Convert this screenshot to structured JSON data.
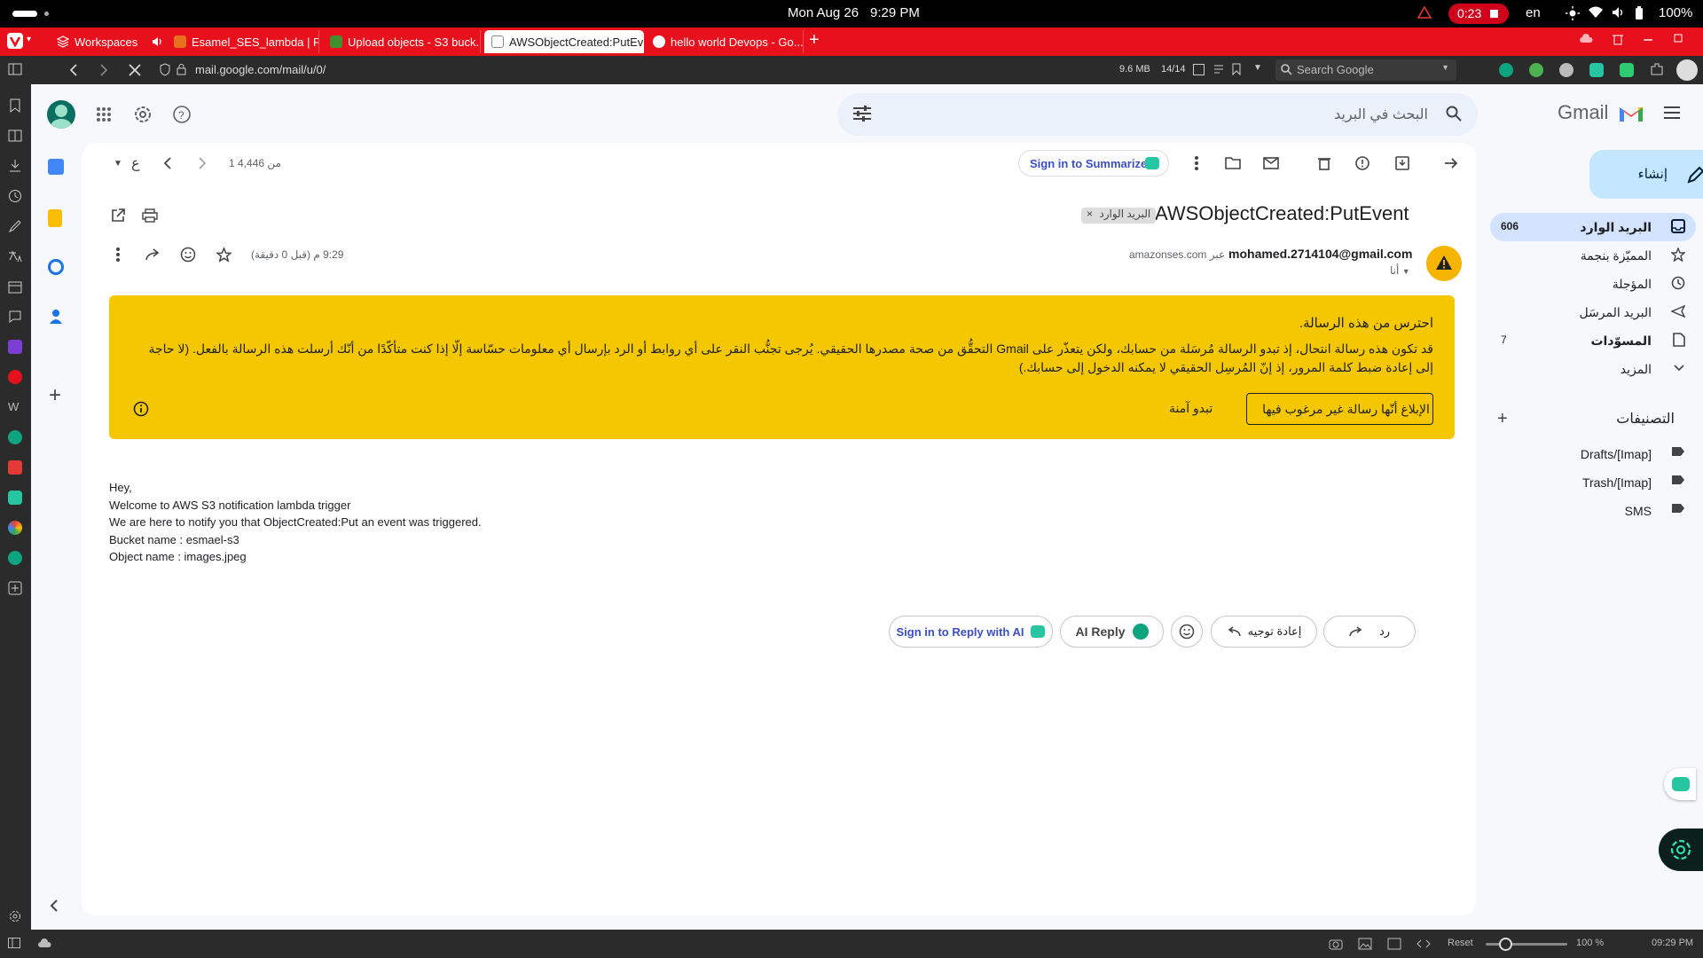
{
  "os": {
    "date": "Mon Aug 26",
    "time": "9:29 PM",
    "recording": "0:23",
    "lang": "en",
    "battery": "100%"
  },
  "browser": {
    "workspaces_label": "Workspaces",
    "tabs": [
      {
        "title": "Esamel_SES_lambda | F...",
        "favicon": "aws-icon"
      },
      {
        "title": "Upload objects - S3 buck...",
        "favicon": "s3-icon"
      },
      {
        "title": "AWSObjectCreated:PutEve",
        "favicon": "doc-icon"
      },
      {
        "title": "hello world Devops - Go...",
        "favicon": "google-icon"
      }
    ],
    "url": "mail.google.com/mail/u/0/",
    "memory": "9.6 MB",
    "tab_count": "14/14",
    "search_placeholder": "Search Google"
  },
  "gmail": {
    "logo": "Gmail",
    "search_placeholder": "البحث في البريد",
    "compose": "إنشاء",
    "nav": [
      {
        "label": "البريد الوارد",
        "count": "606",
        "icon": "inbox-icon",
        "active": true
      },
      {
        "label": "المميّزة بنجمة",
        "count": "",
        "icon": "star-icon"
      },
      {
        "label": "المؤجلة",
        "count": "",
        "icon": "clock-icon"
      },
      {
        "label": "البريد المرسَل",
        "count": "",
        "icon": "send-icon"
      },
      {
        "label": "المسوّدات",
        "count": "7",
        "icon": "draft-icon"
      },
      {
        "label": "المزيد",
        "count": "",
        "icon": "chevron-down-icon"
      }
    ],
    "labels_heading": "التصنيفات",
    "labels": [
      "Drafts/[Imap]",
      "Trash/[Imap]",
      "SMS"
    ],
    "toolbar": {
      "count": "1 من 4,446",
      "sort_letter": "ع",
      "summarize": "Sign in to Summarize"
    },
    "message": {
      "subject": "AWSObjectCreated:PutEvent",
      "chip": "البريد الوارد",
      "sender_email": "mohamed.2714104@gmail.com",
      "via": "عبر amazonses.com",
      "to": "أنا",
      "time": "9:29 م (قبل 0 دقيقة)",
      "banner_title": "احترس من هذه الرسالة.",
      "banner_text": "قد تكون هذه رسالة انتحال، إذ تبدو الرسالة مُرسَلة من حسابك، ولكن يتعذّر على Gmail التحقُّق من صحة مصدرها الحقيقي. يُرجى تجنُّب النقر على أي روابط أو الرد بإرسال أي معلومات حسّاسة إلّا إذا كنت متأكّدًا من أنّك أرسلت هذه الرسالة بالفعل. (لا حاجة إلى إعادة ضبط كلمة المرور، إذ إنّ المُرسِل الحقيقي لا يمكنه الدخول إلى حسابك.)",
      "report_btn": "الإبلاغ أنّها رسالة غير مرغوب فيها",
      "safe_btn": "تبدو آمنة",
      "body": [
        "Hey,",
        "Welcome to AWS S3 notification lambda trigger",
        "We are here to notify you that ObjectCreated:Put an event was triggered.",
        "Bucket name : esmael-s3",
        "Object name : images.jpeg"
      ]
    },
    "actions": {
      "sign_reply": "Sign in to Reply with AI",
      "ai_reply": "AI Reply",
      "forward": "إعادة توجيه",
      "reply": "رد"
    }
  },
  "statusbar": {
    "reset": "Reset",
    "zoom": "100 %",
    "clock": "09:29 PM"
  }
}
